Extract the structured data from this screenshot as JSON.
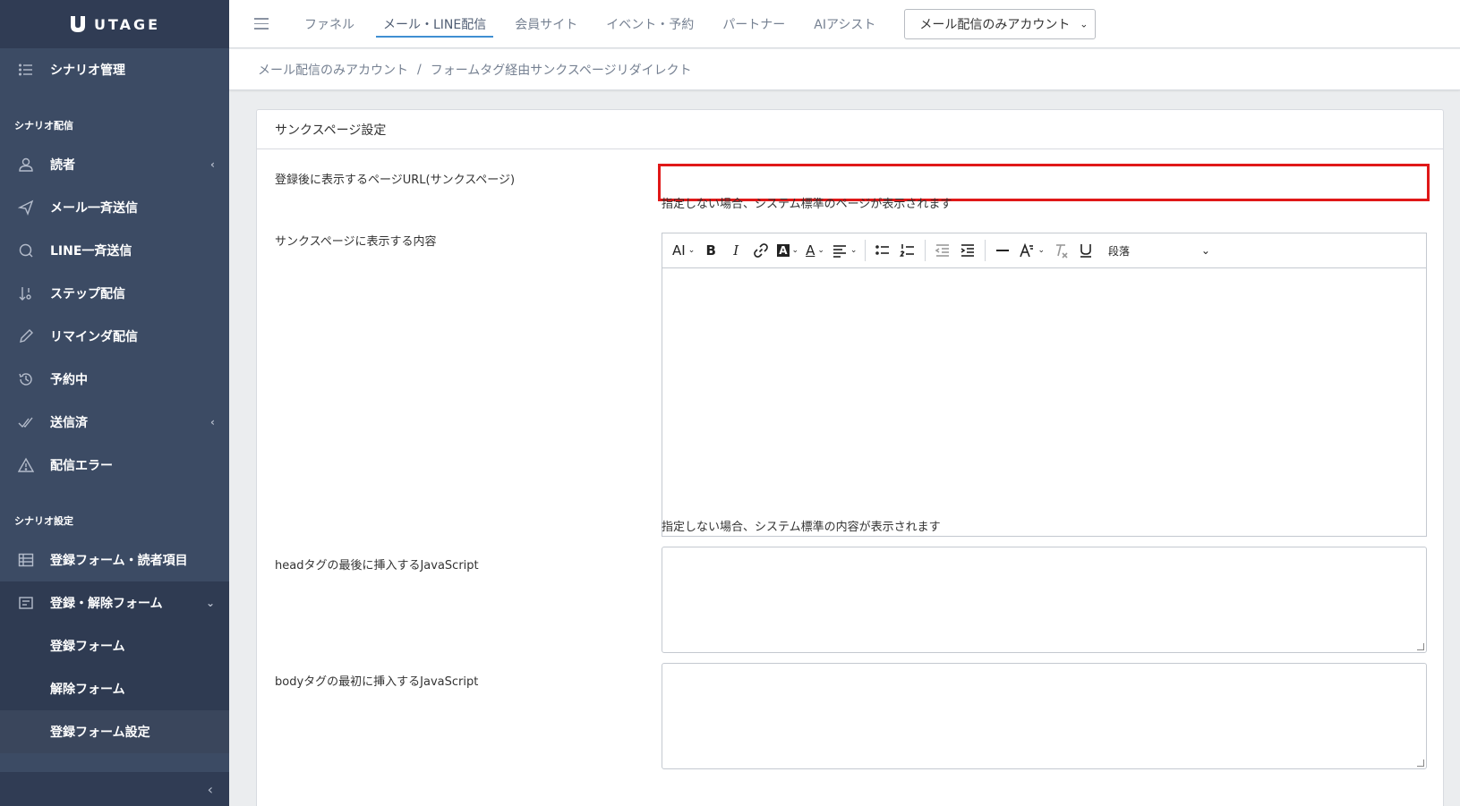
{
  "brand": {
    "name": "UTAGE"
  },
  "sidebar": {
    "top_item": {
      "label": "シナリオ管理",
      "icon": "list-icon"
    },
    "section1_title": "シナリオ配信",
    "section1_items": [
      {
        "label": "読者",
        "icon": "user-icon",
        "has_chevron": true
      },
      {
        "label": "メール一斉送信",
        "icon": "send-icon"
      },
      {
        "label": "LINE一斉送信",
        "icon": "chat-icon"
      },
      {
        "label": "ステップ配信",
        "icon": "sort-icon"
      },
      {
        "label": "リマインダ配信",
        "icon": "pencil-icon"
      },
      {
        "label": "予約中",
        "icon": "history-icon"
      },
      {
        "label": "送信済",
        "icon": "check-double-icon",
        "has_chevron": true
      },
      {
        "label": "配信エラー",
        "icon": "warning-icon"
      }
    ],
    "section2_title": "シナリオ設定",
    "section2_items": [
      {
        "label": "登録フォーム・読者項目",
        "icon": "table-icon"
      },
      {
        "label": "登録・解除フォーム",
        "icon": "form-icon",
        "expanded": true
      }
    ],
    "sub_items": [
      {
        "label": "登録フォーム"
      },
      {
        "label": "解除フォーム"
      },
      {
        "label": "登録フォーム設定",
        "active": true
      }
    ],
    "collapse_glyph": "‹",
    "chevron_left": "‹",
    "chevron_down": "⌄"
  },
  "header": {
    "tabs": [
      {
        "label": "ファネル"
      },
      {
        "label": "メール・LINE配信",
        "active": true
      },
      {
        "label": "会員サイト"
      },
      {
        "label": "イベント・予約"
      },
      {
        "label": "パートナー"
      },
      {
        "label": "AIアシスト"
      }
    ],
    "account_select": {
      "value": "メール配信のみアカウント",
      "caret": "⌄"
    }
  },
  "breadcrumb": {
    "items": [
      "メール配信のみアカウント",
      "フォームタグ経由サンクスページリダイレクト"
    ],
    "separator": "/"
  },
  "card": {
    "title": "サンクスページ設定",
    "url_field": {
      "label": "登録後に表示するページURL(サンクスページ)",
      "value": "",
      "hint": "指定しない場合、システム標準のページが表示されます"
    },
    "content_field": {
      "label": "サンクスページに表示する内容",
      "hint": "指定しない場合、システム標準の内容が表示されます",
      "toolbar": {
        "font_size": "AI",
        "bold": "B",
        "italic": "I",
        "highlight": "A",
        "font_color": "A",
        "paragraph": "段落"
      }
    },
    "head_js": {
      "label": "headタグの最後に挿入するJavaScript",
      "value": ""
    },
    "body_js": {
      "label": "bodyタグの最初に挿入するJavaScript",
      "value": ""
    }
  },
  "colors": {
    "sidebar_bg": "#3c4b64",
    "sidebar_dark": "#303c54",
    "active_tab_underline": "#3f8fd2",
    "highlight_border": "#e01818"
  }
}
